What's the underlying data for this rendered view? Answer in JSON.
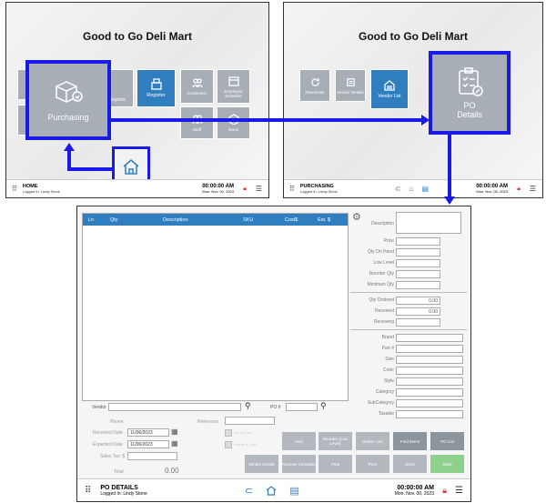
{
  "screen1": {
    "store_name": "Good to Go Deli Mart",
    "tiles": [
      {
        "label": "Purchasing",
        "icon": "box-icon"
      },
      {
        "label": "Reports",
        "icon": "report-icon"
      },
      {
        "label": "Register",
        "icon": "register-icon"
      },
      {
        "label": "Customers",
        "icon": "customers-icon"
      },
      {
        "label": "Employee Schedule",
        "icon": "schedule-icon"
      },
      {
        "label": "Staff",
        "icon": "staff-icon"
      },
      {
        "label": "Items",
        "icon": "items-icon"
      }
    ],
    "status": {
      "title": "HOME",
      "user": "Logged In: Lindy Stone",
      "time": "00:00:00 AM",
      "date": "Mon. Nov. 00, 2023"
    }
  },
  "screen2": {
    "store_name": "Good to Go Deli Mart",
    "tiles": [
      {
        "label": "Reactivate",
        "icon": "refresh-icon"
      },
      {
        "label": "Vendor Details",
        "icon": "vendor-details-icon"
      },
      {
        "label": "Vendor List",
        "icon": "vendor-list-icon"
      },
      {
        "label": "PO Details",
        "icon": "clipboard-icon"
      }
    ],
    "status": {
      "title": "PURCHASING",
      "user": "Logged In: Lindy Stone",
      "time": "00:00:00 AM",
      "date": "Mon. Nov. 00, 2023"
    }
  },
  "screen3": {
    "columns": [
      "Ln",
      "Qty",
      "Description",
      "SKU",
      "Cost$",
      "Ext. $"
    ],
    "description_label": "Description",
    "fields_top": [
      {
        "label": "Price",
        "value": ""
      },
      {
        "label": "Qty On Hand",
        "value": ""
      },
      {
        "label": "Low Level",
        "value": ""
      },
      {
        "label": "Reorder Qty",
        "value": ""
      },
      {
        "label": "Minimum Qty",
        "value": ""
      }
    ],
    "fields_mid": [
      {
        "label": "Qty Ordered",
        "value": "0.00"
      },
      {
        "label": "Received",
        "value": "0.00"
      },
      {
        "label": "Receiving",
        "value": ""
      }
    ],
    "fields_bottom": [
      "Brand",
      "Part #",
      "Size",
      "Color",
      "Style",
      "Category",
      "SubCategory",
      "Taxable"
    ],
    "vendor_label": "Vendor",
    "po_label": "PO #",
    "phone_label": "Phone",
    "reference_label": "Reference",
    "received_date_label": "Received Date",
    "received_date": "11/06/2023",
    "expected_date_label": "Expected Date",
    "expected_date": "11/06/2023",
    "sales_tax_label": "Sales Tax: $",
    "total_label": "Total",
    "total_value": "0.00",
    "check1": "Set As Tax",
    "check2": "Create a Cost",
    "buttons_row1": [
      "Void",
      "Reorder (Low Level)",
      "Delete Line",
      "Find Items",
      "PO List"
    ],
    "buttons_row2": [
      "Vendor Details",
      "Receive Complete",
      "Print",
      "Print",
      "Send",
      "Save"
    ],
    "status": {
      "title": "PO DETAILS",
      "user": "Logged In: Lindy Stone",
      "time": "00:00:00 AM",
      "date": "Mon. Nov. 00, 2023"
    }
  },
  "colors": {
    "highlight": "#1a1ae6",
    "tile_blue": "#2f7fc0",
    "tile_gray": "#a8aeb6",
    "save_green": "#8fd08c"
  }
}
